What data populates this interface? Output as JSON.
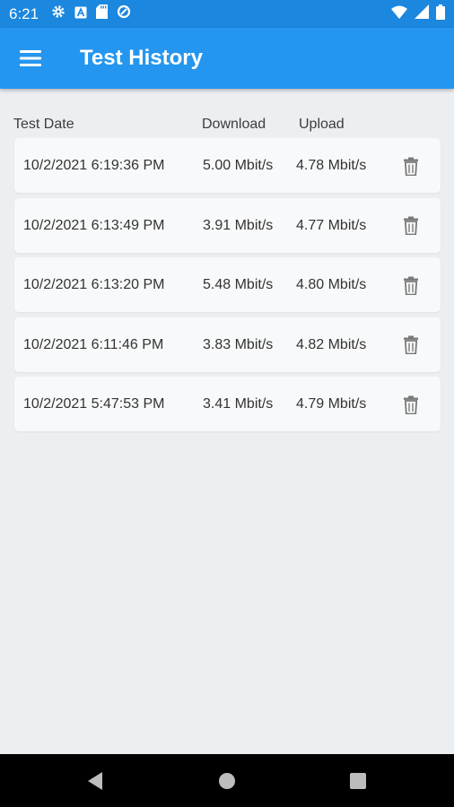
{
  "status_bar": {
    "time": "6:21",
    "left_icons": [
      "gear-icon",
      "a-box-icon",
      "sd-card-icon",
      "data-saver-icon"
    ],
    "right_icons": [
      "wifi-icon",
      "signal-icon",
      "battery-icon"
    ]
  },
  "app_bar": {
    "menu_icon": "hamburger-menu-icon",
    "title": "Test History"
  },
  "colors": {
    "status_bar": "#1b87df",
    "app_bar": "#2496ef",
    "background": "#eceff2",
    "row_background": "#f8f9fa",
    "nav_bar": "#000000"
  },
  "table": {
    "headers": {
      "date": "Test Date",
      "download": "Download",
      "upload": "Upload"
    },
    "rows": [
      {
        "date": "10/2/2021 6:19:36 PM",
        "download": "5.00 Mbit/s",
        "upload": "4.78 Mbit/s"
      },
      {
        "date": "10/2/2021 6:13:49 PM",
        "download": "3.91 Mbit/s",
        "upload": "4.77 Mbit/s"
      },
      {
        "date": "10/2/2021 6:13:20 PM",
        "download": "5.48 Mbit/s",
        "upload": "4.80 Mbit/s"
      },
      {
        "date": "10/2/2021 6:11:46 PM",
        "download": "3.83 Mbit/s",
        "upload": "4.82 Mbit/s"
      },
      {
        "date": "10/2/2021 5:47:53 PM",
        "download": "3.41 Mbit/s",
        "upload": "4.79 Mbit/s"
      }
    ],
    "row_action_icon": "trash-icon"
  },
  "nav_bar": {
    "icons": [
      "back-icon",
      "home-icon",
      "recents-icon"
    ]
  }
}
